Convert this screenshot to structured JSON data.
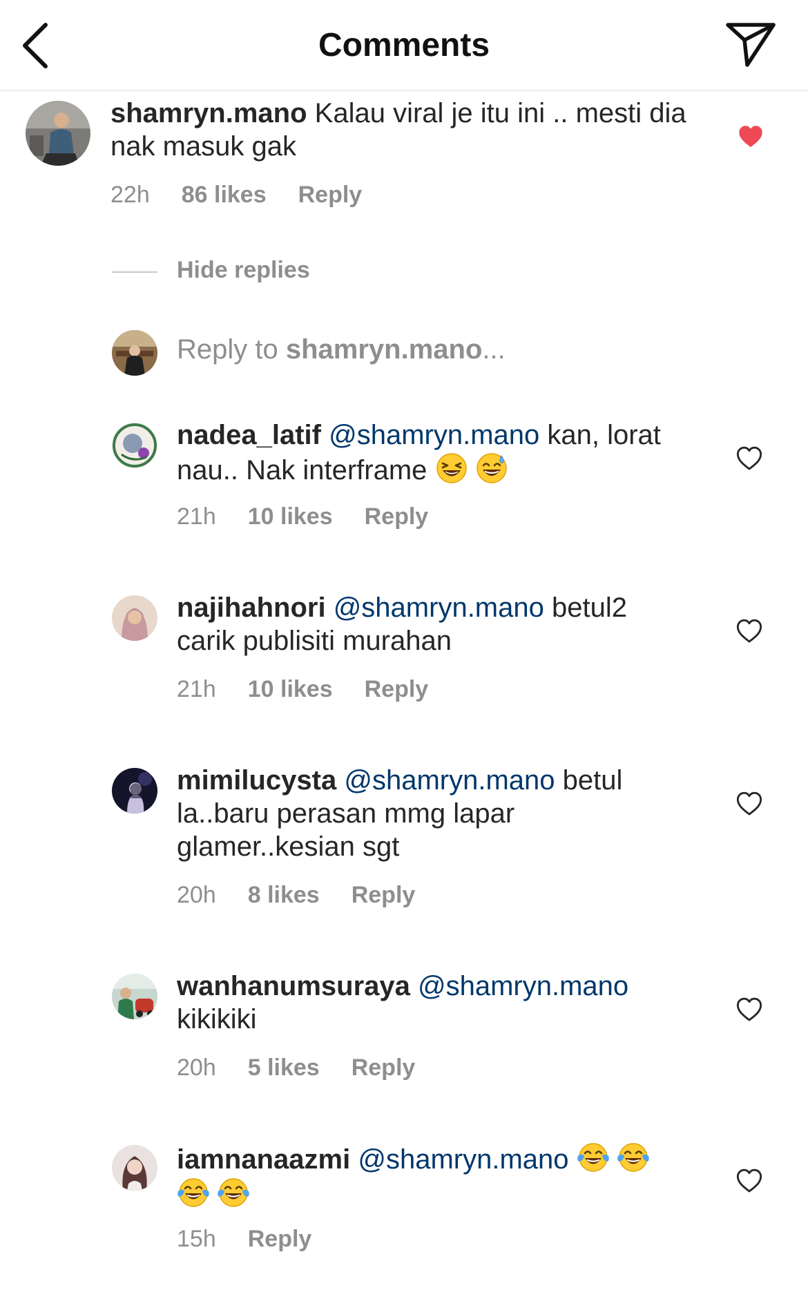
{
  "header": {
    "title": "Comments"
  },
  "icons": {
    "back": "chevron-left-icon",
    "share": "paper-plane-icon",
    "like": "heart-icon",
    "liked": "heart-filled-icon"
  },
  "colors": {
    "liked_heart": "#ed4956",
    "mention": "#00376b",
    "meta": "#8e8e8e"
  },
  "main_comment": {
    "user": "shamryn.mano",
    "text": "Kalau viral je itu ini .. mesti dia nak masuk gak",
    "time": "22h",
    "likes": "86 likes",
    "reply": "Reply",
    "liked": true
  },
  "hide_replies": "Hide replies",
  "reply_prompt": {
    "prefix": "Reply to ",
    "user": "shamryn.mano",
    "suffix": "..."
  },
  "replies": [
    {
      "user": "nadea_latif",
      "mention": "@shamryn.mano",
      "text": "kan, lorat nau.. Nak interframe",
      "emoji": [
        "grinning-squinting-face",
        "grinning-face-with-sweat"
      ],
      "time": "21h",
      "likes": "10 likes",
      "reply": "Reply"
    },
    {
      "user": "najihahnori",
      "mention": "@shamryn.mano",
      "text": "betul2 carik publisiti murahan",
      "time": "21h",
      "likes": "10 likes",
      "reply": "Reply"
    },
    {
      "user": "mimilucysta",
      "mention": "@shamryn.mano",
      "text": "betul la..baru perasan mmg lapar glamer..kesian sgt",
      "time": "20h",
      "likes": "8 likes",
      "reply": "Reply"
    },
    {
      "user": "wanhanumsuraya",
      "mention": "@shamryn.mano",
      "text": "kikikiki",
      "time": "20h",
      "likes": "5 likes",
      "reply": "Reply"
    },
    {
      "user": "iamnanaazmi",
      "mention": "@shamryn.mano",
      "text": "",
      "emoji": [
        "face-with-tears-of-joy",
        "face-with-tears-of-joy",
        "face-with-tears-of-joy",
        "face-with-tears-of-joy"
      ],
      "time": "15h",
      "reply": "Reply"
    }
  ]
}
